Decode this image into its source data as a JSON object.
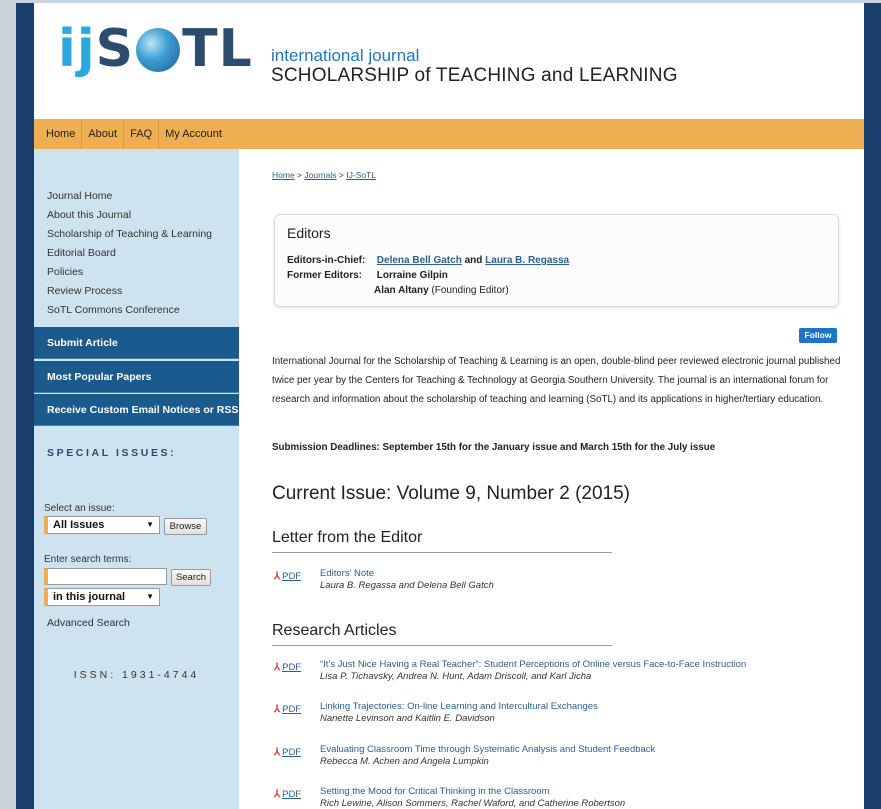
{
  "header": {
    "logo_ij": "ij",
    "logo_s": "S",
    "logo_rest": "TL",
    "title_small": "international journal",
    "title_big": "SCHOLARSHIP of TEACHING and LEARNING"
  },
  "nav": [
    "Home",
    "About",
    "FAQ",
    "My Account"
  ],
  "sidebar": {
    "links": [
      "Journal Home",
      "About this Journal",
      "Scholarship of Teaching & Learning",
      "Editorial Board",
      "Policies",
      "Review Process",
      "SoTL Commons Conference"
    ],
    "buttons": [
      "Submit Article",
      "Most Popular Papers",
      "Receive Custom Email Notices or RSS"
    ],
    "special_issues": "SPECIAL ISSUES:",
    "select_label": "Select an issue:",
    "select_value": "All Issues",
    "browse": "Browse",
    "search_label": "Enter search terms:",
    "search_value": "",
    "search_button": "Search",
    "scope_value": "in this journal",
    "advanced": "Advanced Search",
    "issn": "ISSN: 1931-4744"
  },
  "breadcrumb": [
    "Home",
    "Journals",
    "IJ-SoTL"
  ],
  "editors": {
    "title": "Editors",
    "chief_label": "Editors-in-Chief:",
    "chief_1": "Delena Bell Gatch",
    "chief_and": "and",
    "chief_2": "Laura B. Regassa",
    "former_label": "Former Editors:",
    "former_1": "Lorraine Gilpin",
    "former_2_name": "Alan Altany",
    "former_2_note": "(Founding Editor)"
  },
  "follow": "Follow",
  "description": "International Journal for the Scholarship of Teaching & Learning is an open, double-blind peer reviewed electronic journal published twice per year by the Centers for Teaching & Technology at Georgia Southern University. The journal is an international forum for research and information about the scholarship of teaching and learning (SoTL) and its applications in higher/tertiary education.",
  "deadlines": "Submission Deadlines: September 15th for the January issue and March 15th for the July issue",
  "current_issue": "Current Issue: Volume 9, Number 2 (2015)",
  "sections": {
    "letter": {
      "heading": "Letter from the Editor",
      "articles": [
        {
          "pdf": "PDF",
          "title": "Editors' Note",
          "authors": "Laura B. Regassa and Delena Bell Gatch"
        }
      ]
    },
    "research": {
      "heading": "Research Articles",
      "articles": [
        {
          "pdf": "PDF",
          "title": "“It’s Just Nice Having a Real Teacher”: Student Perceptions of Online versus Face-to-Face Instruction",
          "authors": "Lisa P. Tichavsky, Andrea N. Hunt, Adam Driscoll, and Karl Jicha"
        },
        {
          "pdf": "PDF",
          "title": "Linking Trajectories: On-line Learning and Intercultural Exchanges",
          "authors": "Nanette Levinson and Kaitlin E. Davidson"
        },
        {
          "pdf": "PDF",
          "title": "Evaluating Classroom Time through Systematic Analysis and Student Feedback",
          "authors": "Rebecca M. Achen and Angela Lumpkin"
        },
        {
          "pdf": "PDF",
          "title": "Setting the Mood for Critical Thinking in the Classroom",
          "authors": "Rich Lewine, Alison Sommers, Rachel Waford, and Catherine Robertson"
        }
      ]
    }
  }
}
